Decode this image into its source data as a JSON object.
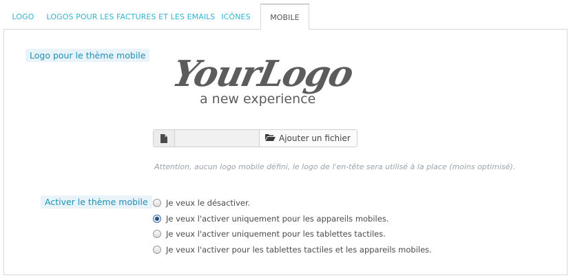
{
  "tabs": [
    {
      "label": "LOGO",
      "active": false
    },
    {
      "label": "LOGOS POUR LES FACTURES ET LES EMAILS",
      "active": false
    },
    {
      "label": "ICÔNES",
      "active": false
    },
    {
      "label": "MOBILE",
      "active": true
    }
  ],
  "mobile_logo": {
    "label": "Logo pour le thème mobile",
    "image_main_text": "YourLogo",
    "image_sub_text": "a new experience",
    "file_icon": "file-icon",
    "folder_icon": "folder-open-icon",
    "add_file_label": "Ajouter un fichier",
    "file_input_value": "",
    "help_text": "Attention, aucun logo mobile défini, le logo de l'en-tête sera utilisé à la place (moins optimisé)."
  },
  "mobile_theme": {
    "label": "Activer le thème mobile",
    "options": [
      {
        "label": "Je veux le désactiver.",
        "checked": false
      },
      {
        "label": "Je veux l'activer uniquement pour les appareils mobiles.",
        "checked": true
      },
      {
        "label": "Je veux l'activer uniquement pour les tablettes tactiles.",
        "checked": false
      },
      {
        "label": "Je veux l'activer pour les tablettes tactiles et les appareils mobiles.",
        "checked": false
      }
    ]
  },
  "colors": {
    "tab_link": "#2fb5d2",
    "label_bg": "#e8f4fa",
    "label_text": "#1f8fb3",
    "help_text": "#9aa4ab",
    "logo_dark": "#5c5c5c"
  }
}
